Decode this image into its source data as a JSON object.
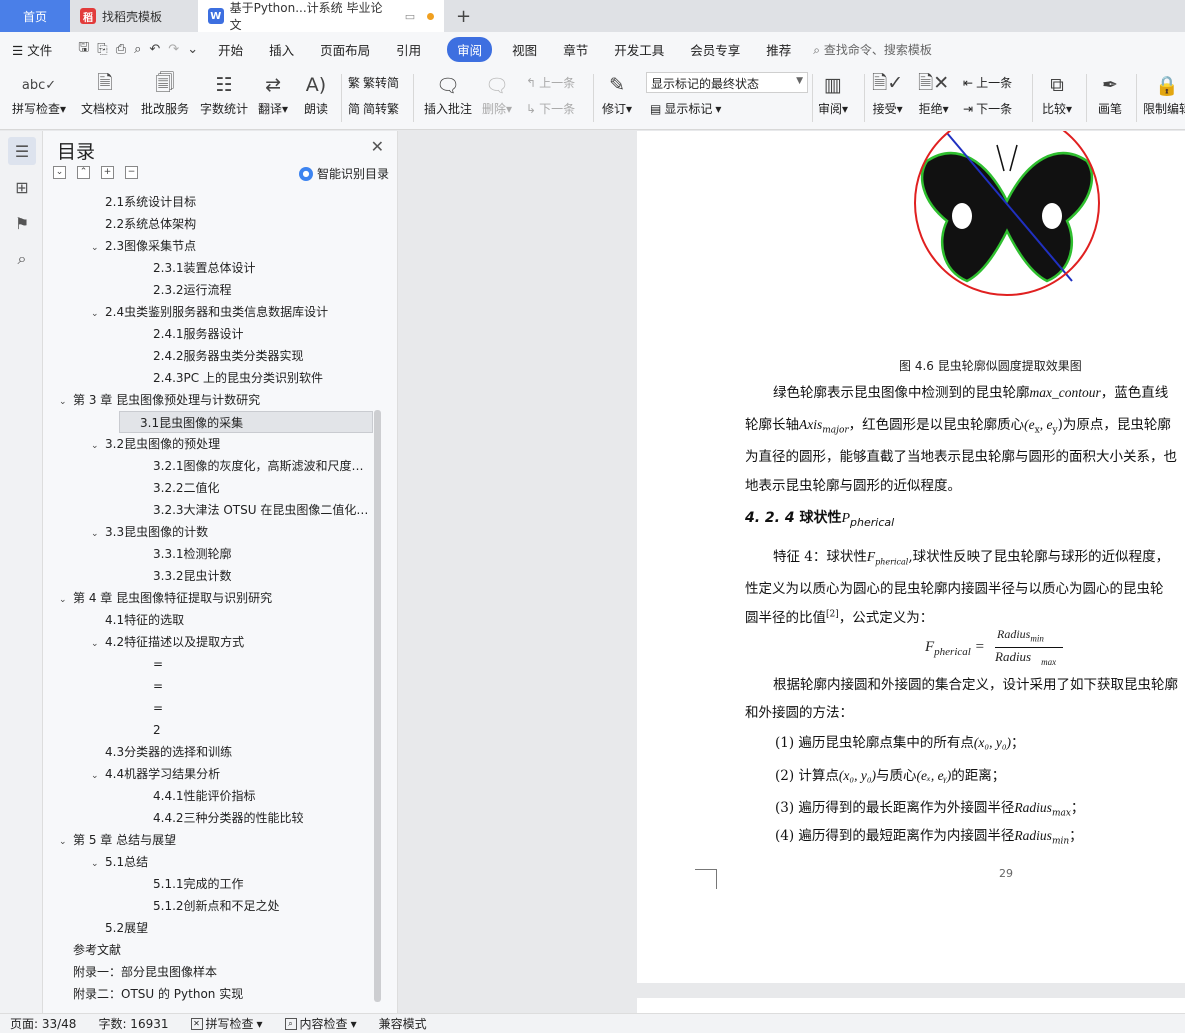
{
  "tabs": {
    "home": "首页",
    "t2": "找稻壳模板",
    "t3": "基于Python...计系统 毕业论文"
  },
  "menu": {
    "file": "文件",
    "items": [
      "开始",
      "插入",
      "页面布局",
      "引用",
      "审阅",
      "视图",
      "章节",
      "开发工具",
      "会员专享",
      "推荐"
    ],
    "active_index": 4,
    "search": "查找命令、搜索模板"
  },
  "ribbon": {
    "spell": "拼写检查",
    "doccheck": "文档校对",
    "batch": "批改服务",
    "wordcount": "字数统计",
    "translate": "翻译",
    "read": "朗读",
    "trad": "繁转简",
    "simp": "简转繁",
    "insert_comment": "插入批注",
    "delete": "删除",
    "prev": "上一条",
    "next": "下一条",
    "revise": "修订",
    "markup_combo": "显示标记的最终状态",
    "show_markup": "显示标记",
    "review": "审阅",
    "accept": "接受",
    "reject": "拒绝",
    "prev2": "上一条",
    "next2": "下一条",
    "compare": "比较",
    "pen": "画笔",
    "restrict": "限制编辑"
  },
  "toc": {
    "title": "目录",
    "smart": "智能识别目录",
    "items": [
      {
        "text": "2.1系统设计目标",
        "level": 2,
        "chev": false
      },
      {
        "text": "2.2系统总体架构",
        "level": 2,
        "chev": false
      },
      {
        "text": "2.3图像采集节点",
        "level": 2,
        "chev": true
      },
      {
        "text": "2.3.1装置总体设计",
        "level": 3,
        "chev": false
      },
      {
        "text": "2.3.2运行流程",
        "level": 3,
        "chev": false
      },
      {
        "text": "2.4虫类鉴别服务器和虫类信息数据库设计",
        "level": 2,
        "chev": true
      },
      {
        "text": "2.4.1服务器设计",
        "level": 3,
        "chev": false
      },
      {
        "text": "2.4.2服务器虫类分类器实现",
        "level": 3,
        "chev": false
      },
      {
        "text": "2.4.3PC 上的昆虫分类识别软件",
        "level": 3,
        "chev": false
      },
      {
        "text": "第 3 章 昆虫图像预处理与计数研究",
        "level": 1,
        "chev": true
      },
      {
        "text": "3.1昆虫图像的采集",
        "level": 2,
        "chev": false,
        "sel": true
      },
      {
        "text": "3.2昆虫图像的预处理",
        "level": 2,
        "chev": true
      },
      {
        "text": "3.2.1图像的灰度化，高斯滤波和尺度…",
        "level": 3,
        "chev": false
      },
      {
        "text": "3.2.2二值化",
        "level": 3,
        "chev": false
      },
      {
        "text": "3.2.3大津法 OTSU 在昆虫图像二值化…",
        "level": 3,
        "chev": false
      },
      {
        "text": "3.3昆虫图像的计数",
        "level": 2,
        "chev": true
      },
      {
        "text": "3.3.1检测轮廓",
        "level": 3,
        "chev": false
      },
      {
        "text": "3.3.2昆虫计数",
        "level": 3,
        "chev": false
      },
      {
        "text": "第 4 章 昆虫图像特征提取与识别研究",
        "level": 1,
        "chev": true
      },
      {
        "text": "4.1特征的选取",
        "level": 2,
        "chev": false
      },
      {
        "text": "4.2特征描述以及提取方式",
        "level": 2,
        "chev": true
      },
      {
        "text": "=",
        "level": 3,
        "chev": false,
        "indent": 96
      },
      {
        "text": "=",
        "level": 3,
        "chev": false,
        "indent": 96
      },
      {
        "text": "=",
        "level": 3,
        "chev": false,
        "indent": 96
      },
      {
        "text": "2",
        "level": 3,
        "chev": false,
        "indent": 96
      },
      {
        "text": "4.3分类器的选择和训练",
        "level": 2,
        "chev": false
      },
      {
        "text": "4.4机器学习结果分析",
        "level": 2,
        "chev": true
      },
      {
        "text": "4.4.1性能评价指标",
        "level": 3,
        "chev": false
      },
      {
        "text": "4.4.2三种分类器的性能比较",
        "level": 3,
        "chev": false
      },
      {
        "text": "第 5 章 总结与展望",
        "level": 1,
        "chev": true
      },
      {
        "text": "5.1总结",
        "level": 2,
        "chev": true
      },
      {
        "text": "5.1.1完成的工作",
        "level": 3,
        "chev": false
      },
      {
        "text": "5.1.2创新点和不足之处",
        "level": 3,
        "chev": false
      },
      {
        "text": "5.2展望",
        "level": 2,
        "chev": false
      },
      {
        "text": "参考文献",
        "level": 1,
        "chev": false
      },
      {
        "text": "附录一：部分昆虫图像样本",
        "level": 1,
        "chev": false
      },
      {
        "text": "附录二：OTSU 的 Python 实现",
        "level": 1,
        "chev": false
      }
    ]
  },
  "doc": {
    "caption": "图 4.6 昆虫轮廓似圆度提取效果图",
    "p1a": "绿色轮廓表示昆虫图像中检测到的昆虫轮廓",
    "p1a_var": "max_contour",
    "p1a_tail": "，蓝色直线",
    "p1b_pre": "轮廓长轴",
    "p1b_axis": "Axis",
    "p1b_axis_sub": "major",
    "p1b_mid": "，红色圆形是以昆虫轮廓质心",
    "p1b_pt": "(e",
    "p1b_pt_x": "x",
    "p1b_pt_c": ", e",
    "p1b_pt_y": "y",
    "p1b_tail": ")为原点，昆虫轮廓",
    "p1c": "为直径的圆形，能够直截了当地表示昆虫轮廓与圆形的面积大小关系，也",
    "p1d": "地表示昆虫轮廓与圆形的近似程度。",
    "heading_num": "4. 2. 4",
    "heading_txt": "球状性",
    "heading_var": "P",
    "heading_sub": "pherical",
    "p2a_pre": "特征 4：球状性",
    "p2a_var": "F",
    "p2a_sub": "pherical",
    "p2a_tail": ",球状性反映了昆虫轮廓与球形的近似程度，",
    "p2b": "性定义为以质心为圆心的昆虫轮廓内接圆半径与以质心为圆心的昆虫轮",
    "p2c": "圆半径的比值",
    "p2c_ref": "[2]",
    "p2c_tail": "，公式定义为：",
    "f_lhs": "F",
    "f_lhs_sub": "pherical",
    "f_num": "Radius",
    "f_num_sub": "min",
    "f_den": "Radius",
    "f_den_sub": "max",
    "p3a": "根据轮廓内接圆和外接圆的集合定义，设计采用了如下获取昆虫轮廓",
    "p3b": "和外接圆的方法：",
    "s1": "(1) 遍历昆虫轮廓点集中的所有点",
    "s1_var": "(x₀, y₀)",
    "s1_tail": "；",
    "s2": "(2) 计算点",
    "s2_var": "(x₀, y₀)",
    "s2_mid": "与质心",
    "s2_var2": "(eₓ, eᵧ)",
    "s2_tail": "的距离；",
    "s3": "(3) 遍历得到的最长距离作为外接圆半径",
    "s3_var": "Radius",
    "s3_sub": "max",
    "s3_tail": "；",
    "s4": "(4) 遍历得到的最短距离作为内接圆半径",
    "s4_var": "Radius",
    "s4_sub": "min",
    "s4_tail": "；",
    "page_number": "29"
  },
  "status": {
    "page": "页面: 33/48",
    "words": "字数: 16931",
    "spell": "拼写检查",
    "content": "内容检查",
    "compat": "兼容模式"
  },
  "colors": {
    "accent": "#3d6fe0",
    "home_tab": "#4a7fe8",
    "contour": "#2fbf2f",
    "circle": "#e02020",
    "axis_line": "#2030c0"
  }
}
